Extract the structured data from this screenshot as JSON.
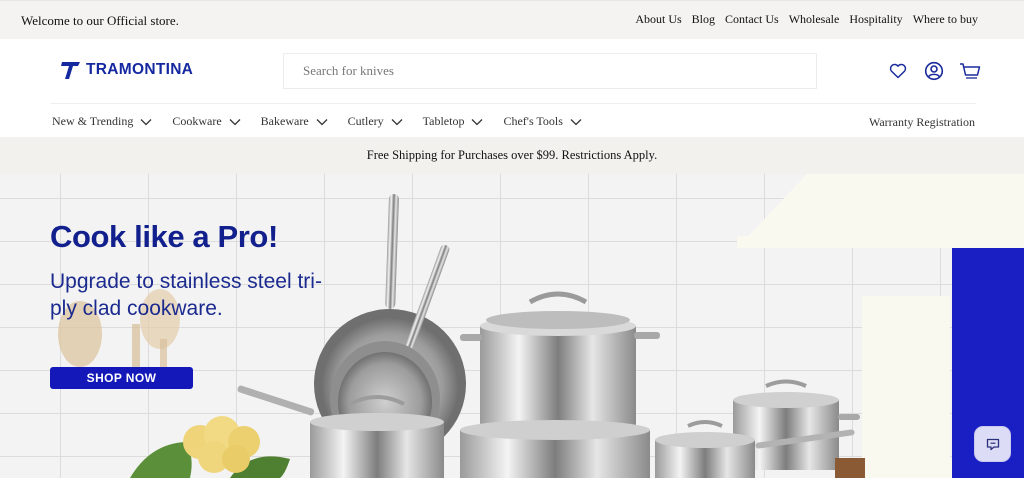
{
  "utility": {
    "welcome": "Welcome to our Official store.",
    "links": [
      "About Us",
      "Blog",
      "Contact Us",
      "Wholesale",
      "Hospitality",
      "Where to buy"
    ]
  },
  "header": {
    "logo_text": "TRAMONTINA",
    "search_placeholder": "Search for knives",
    "icons": [
      "heart-icon",
      "account-icon",
      "cart-icon"
    ]
  },
  "nav": {
    "items": [
      "New & Trending",
      "Cookware",
      "Bakeware",
      "Cutlery",
      "Tabletop",
      "Chef's Tools"
    ],
    "right": "Warranty Registration"
  },
  "promo": {
    "text": "Free Shipping for Purchases over $99. Restrictions Apply."
  },
  "hero": {
    "title": "Cook like a Pro!",
    "subtitle": "Upgrade to stainless steel tri-ply clad cookware.",
    "button": "SHOP NOW"
  },
  "colors": {
    "brand_blue": "#1428a0",
    "button_blue": "#1418b8",
    "accent_block": "#1a1fc4"
  }
}
